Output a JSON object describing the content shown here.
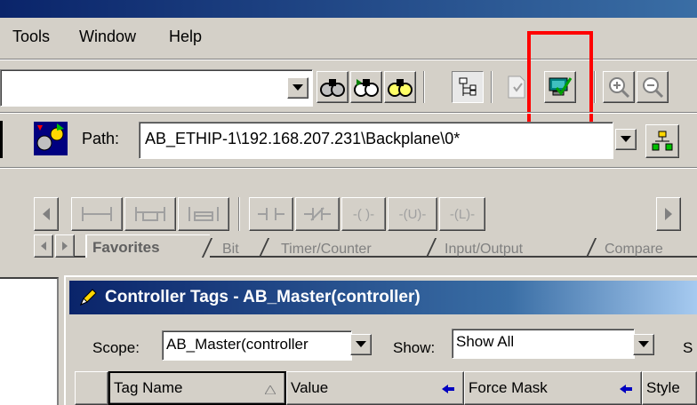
{
  "menu": {
    "tools": "Tools",
    "window": "Window",
    "help": "Help"
  },
  "toolbar": {
    "search_combo_value": "",
    "icons": [
      "find-icon",
      "find-next-icon",
      "find-previous-icon",
      "tag-browser-icon",
      "verify-routine-icon",
      "verify-controller-icon",
      "zoom-in-icon",
      "zoom-out-icon"
    ]
  },
  "path_bar": {
    "label": "Path:",
    "value": "AB_ETHIP-1\\192.168.207.231\\Backplane\\0*"
  },
  "instruction_palette": {
    "buttons": [
      "rung",
      "branch",
      "branch-level",
      "xic",
      "xio",
      "ote",
      "otl",
      "otu"
    ],
    "ote_label": "-( )-",
    "otl_label": "-(L)-",
    "otu_label": "-(U)-",
    "tabs": [
      "Favorites",
      "Bit",
      "Timer/Counter",
      "Input/Output",
      "Compare"
    ]
  },
  "controller_tags": {
    "title": "Controller Tags - AB_Master(controller)",
    "scope_label": "Scope:",
    "scope_value": "AB_Master(controller",
    "show_label": "Show:",
    "show_value": "Show All",
    "cut_label": "S",
    "columns": [
      "Tag Name",
      "Value",
      "Force Mask",
      "Style"
    ]
  }
}
